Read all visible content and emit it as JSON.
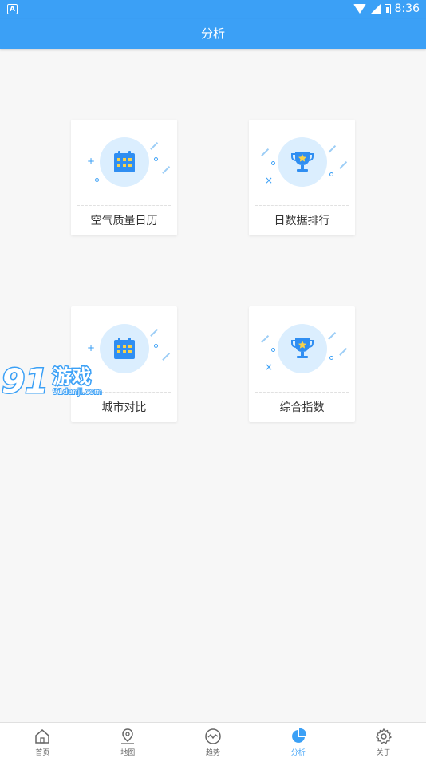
{
  "status_bar": {
    "time": "8:36",
    "left_icon_letter": "A"
  },
  "header": {
    "title": "分析"
  },
  "cards": [
    {
      "label": "空气质量日历",
      "icon": "calendar-icon"
    },
    {
      "label": "日数据排行",
      "icon": "trophy-icon"
    },
    {
      "label": "城市对比",
      "icon": "calendar-icon"
    },
    {
      "label": "综合指数",
      "icon": "trophy-icon"
    }
  ],
  "watermark": {
    "brand": "游戏",
    "number": "91",
    "site": "91danji.com"
  },
  "tabs": [
    {
      "label": "首页",
      "icon": "home-icon"
    },
    {
      "label": "地图",
      "icon": "map-pin-icon"
    },
    {
      "label": "趋势",
      "icon": "trend-icon"
    },
    {
      "label": "分析",
      "icon": "pie-chart-icon",
      "active": true
    },
    {
      "label": "关于",
      "icon": "gear-icon"
    }
  ],
  "colors": {
    "primary": "#3ba0f6",
    "icon_bg": "#dbeefe",
    "trophy_star": "#f8d24a",
    "calendar_cell": "#f8d24a"
  }
}
